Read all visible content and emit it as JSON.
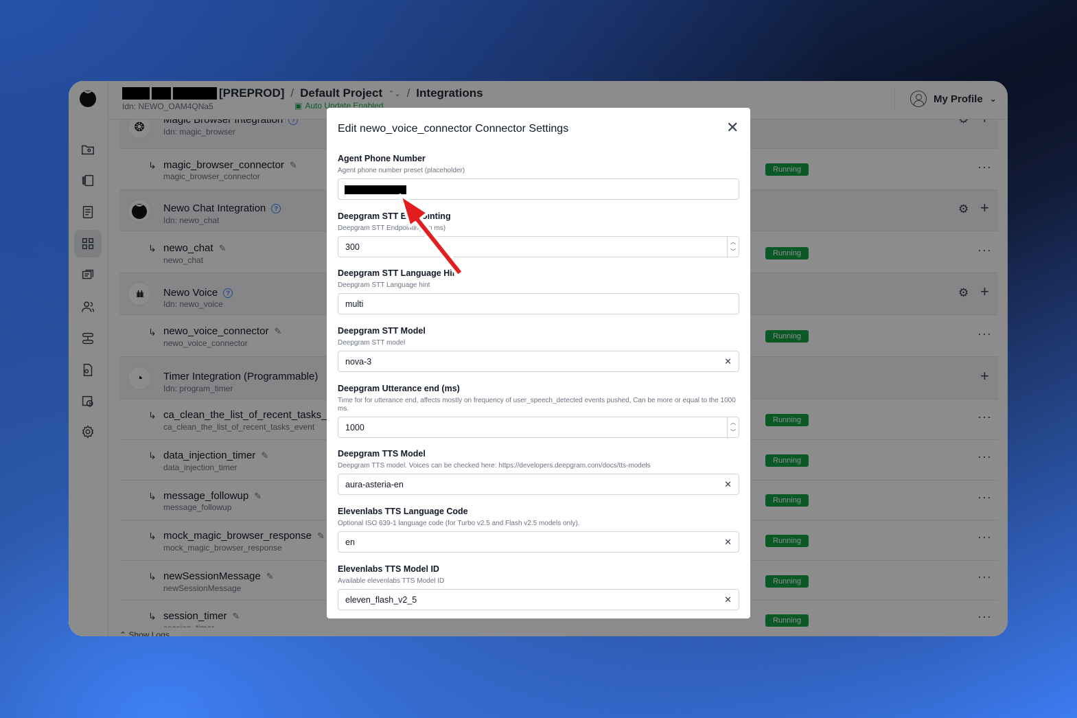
{
  "header": {
    "env_tag": "[PREPROD]",
    "project": "Default Project",
    "page": "Integrations",
    "idn": "Idn: NEWO_OAM4QNa5",
    "auto_update": "Auto Update Enabled",
    "profile_label": "My Profile"
  },
  "sidebar": {
    "icons": [
      "projects-icon",
      "flows-icon",
      "documents-icon",
      "integrations-icon",
      "chats-icon",
      "personas-icon",
      "workflows-icon",
      "files-icon",
      "schedules-icon",
      "settings-icon"
    ],
    "active": "integrations-icon"
  },
  "integrations": [
    {
      "type": "group",
      "title": "Magic Browser Integration",
      "idn": "Idn: magic_browser",
      "icon": "openai-icon",
      "gear": true
    },
    {
      "type": "connector",
      "title": "magic_browser_connector",
      "sub": "magic_browser_connector",
      "status": "Running"
    },
    {
      "type": "group",
      "title": "Newo Chat Integration",
      "idn": "Idn: newo_chat",
      "icon": "newo-logo-icon",
      "gear": true
    },
    {
      "type": "connector",
      "title": "newo_chat",
      "sub": "newo_chat",
      "status": "Running"
    },
    {
      "type": "group",
      "title": "Newo Voice",
      "idn": "Idn: newo_voice",
      "icon": "waveform-icon",
      "gear": true
    },
    {
      "type": "connector",
      "title": "newo_voice_connector",
      "sub": "newo_voice_connector",
      "status": "Running"
    },
    {
      "type": "group",
      "title": "Timer Integration (Programmable)",
      "idn": "Idn: program_timer",
      "icon": "timer-icon",
      "gear": false
    },
    {
      "type": "connector",
      "title": "ca_clean_the_list_of_recent_tasks_e",
      "sub": "ca_clean_the_list_of_recent_tasks_event",
      "status": "Running"
    },
    {
      "type": "connector",
      "title": "data_injection_timer",
      "sub": "data_injection_timer",
      "status": "Running"
    },
    {
      "type": "connector",
      "title": "message_followup",
      "sub": "message_followup",
      "status": "Running"
    },
    {
      "type": "connector",
      "title": "mock_magic_browser_response",
      "sub": "mock_magic_browser_response",
      "status": "Running"
    },
    {
      "type": "connector",
      "title": "newSessionMessage",
      "sub": "newSessionMessage",
      "status": "Running"
    },
    {
      "type": "connector",
      "title": "session_timer",
      "sub": "session_timer",
      "status": "Running"
    }
  ],
  "show_logs": "Show Logs",
  "modal": {
    "title": "Edit newo_voice_connector Connector Settings",
    "fields": [
      {
        "label": "Agent Phone Number",
        "desc": "Agent phone number preset (placeholder)",
        "value": "",
        "redacted": true,
        "control": "text"
      },
      {
        "label": "Deepgram STT Endpointing",
        "desc": "Deepgram STT Endpointing (in ms)",
        "value": "300",
        "control": "number"
      },
      {
        "label": "Deepgram STT Language Hint",
        "desc": "Deepgram STT Language hint",
        "value": "multi",
        "control": "text"
      },
      {
        "label": "Deepgram STT Model",
        "desc": "Deepgram STT model",
        "value": "nova-3",
        "control": "clearable"
      },
      {
        "label": "Deepgram Utterance end (ms)",
        "desc": "Time for for utterance end, affects mostly on frequency of user_speech_detected events pushed, Can be more or equal to the 1000 ms.",
        "value": "1000",
        "control": "number"
      },
      {
        "label": "Deepgram TTS Model",
        "desc": "Deepgram TTS model. Voices can be checked here: https://developers.deepgram.com/docs/tts-models",
        "value": "aura-asteria-en",
        "control": "clearable"
      },
      {
        "label": "Elevenlabs TTS Language Code",
        "desc": "Optional ISO 639-1 language code (for Turbo v2.5 and Flash v2.5 models only).",
        "value": "en",
        "control": "clearable"
      },
      {
        "label": "Elevenlabs TTS Model ID",
        "desc": "Available elevenlabs TTS Model ID",
        "value": "eleven_flash_v2_5",
        "control": "clearable"
      }
    ]
  },
  "colors": {
    "running": "#16a34a",
    "annotation_arrow": "#e11d1d",
    "help": "#3b82f6"
  }
}
